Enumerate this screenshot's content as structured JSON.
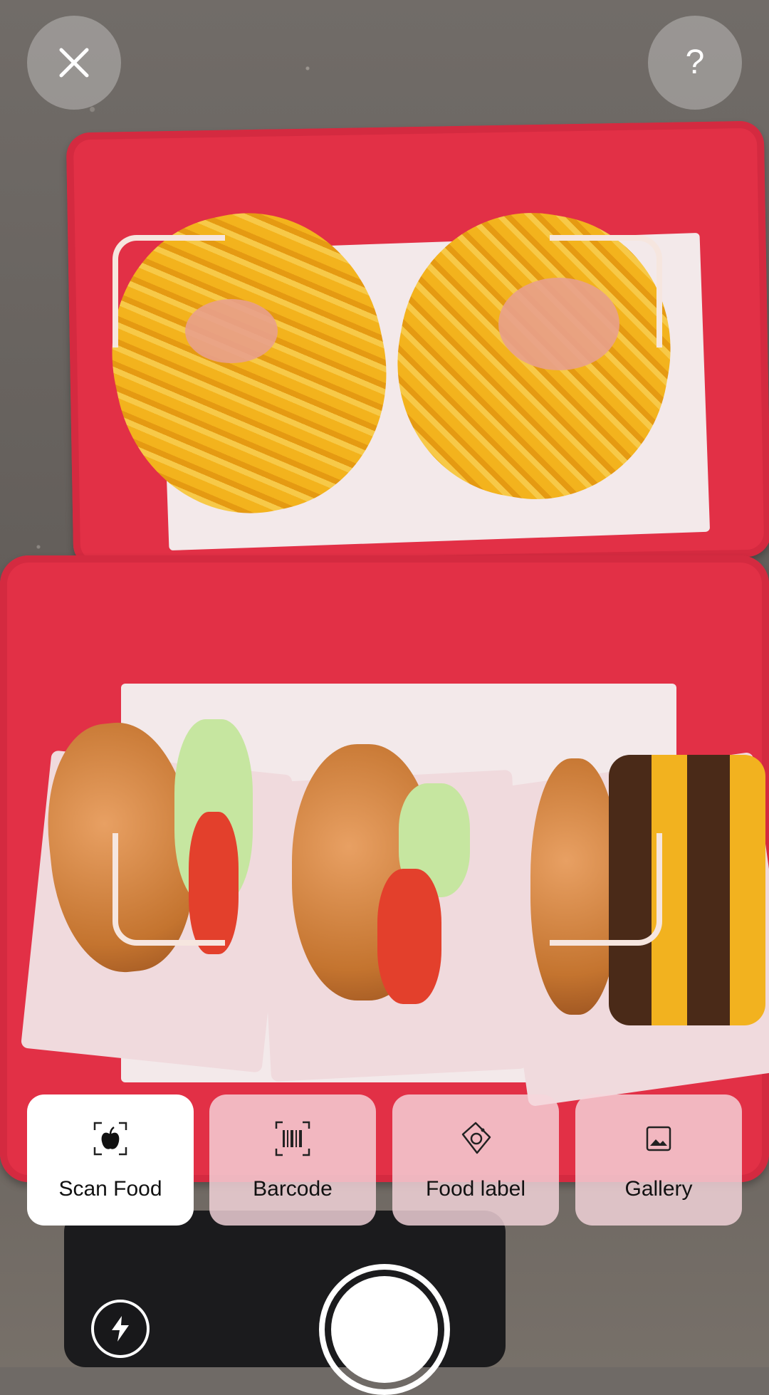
{
  "top_bar": {
    "close_icon": "close-icon",
    "help_label": "?"
  },
  "modes": [
    {
      "label": "Scan Food",
      "icon": "scan-food-icon",
      "active": true
    },
    {
      "label": "Barcode",
      "icon": "barcode-icon",
      "active": false
    },
    {
      "label": "Food label",
      "icon": "food-label-icon",
      "active": false
    },
    {
      "label": "Gallery",
      "icon": "gallery-icon",
      "active": false
    }
  ],
  "controls": {
    "flash_icon": "flash-icon",
    "shutter_icon": "shutter-button"
  },
  "colors": {
    "active_mode_bg": "#ffffff",
    "inactive_mode_bg": "#f5d6dc",
    "frame_corner": "#f6e6df",
    "tray": "#e23046"
  }
}
